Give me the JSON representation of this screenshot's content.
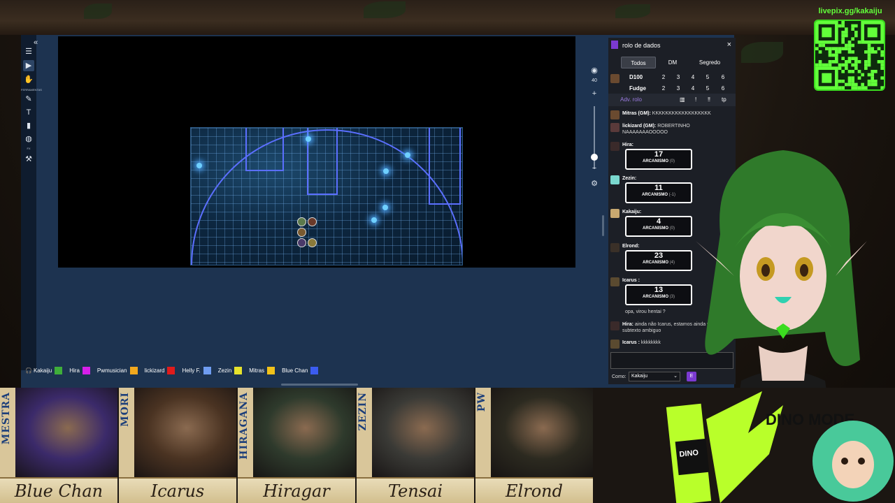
{
  "overlay": {
    "qr_label": "livepix.gg/kakaiju",
    "dino_text": "DINO MODE"
  },
  "vtt": {
    "tools": [
      {
        "name": "menu-icon",
        "glyph": "☰"
      },
      {
        "name": "select-tool-icon",
        "glyph": "▶"
      },
      {
        "name": "hand-tool-icon",
        "glyph": "✋"
      },
      {
        "name": "brush-tool-icon",
        "glyph": "✎"
      },
      {
        "name": "text-tool-icon",
        "glyph": "T"
      },
      {
        "name": "ruler-tool-icon",
        "glyph": "▮"
      },
      {
        "name": "globe-tool-icon",
        "glyph": "◍"
      },
      {
        "name": "wand-tool-icon",
        "glyph": "⚒"
      }
    ],
    "tools_label": "FERRAMENTAS",
    "fx_label": "FX",
    "zoom_level": "40",
    "players": [
      {
        "name": "Kakaiju",
        "color": "#3fae3a"
      },
      {
        "name": "Hira",
        "color": "#d61fe8"
      },
      {
        "name": "Pwmusician",
        "color": "#f2a81d"
      },
      {
        "name": "lickizard",
        "color": "#e01b1b"
      },
      {
        "name": "Helly F.",
        "color": "#6f9cf0"
      },
      {
        "name": "Zezin",
        "color": "#e6e22c"
      },
      {
        "name": "Mitras",
        "color": "#f2c21a"
      },
      {
        "name": "Blue Chan",
        "color": "#3b5cf0"
      }
    ]
  },
  "dice_panel": {
    "title": "rolo de dados",
    "close": "×",
    "tabs": [
      "Todos",
      "DM",
      "Segredo"
    ],
    "dice_rows": [
      {
        "die": "D100",
        "values": [
          "2",
          "3",
          "4",
          "5",
          "6"
        ]
      },
      {
        "die": "Fudge",
        "values": [
          "2",
          "3",
          "4",
          "5",
          "6"
        ]
      }
    ],
    "adv_label": "Adv. rolo",
    "adv_buttons": [
      "▥",
      "!",
      "‼",
      "tp"
    ],
    "chat": [
      {
        "who": "Mitras (GM):",
        "text": "KKKKKKKKKKKKKKKKKK"
      },
      {
        "who": "lickizard (GM):",
        "text": "ROBERTINHO NAAAAAAAOOOOO"
      },
      {
        "who": "Hira:",
        "roll": "17",
        "skill": "ARCANISMO",
        "mod": "(0)"
      },
      {
        "who": "Zezin:",
        "roll": "11",
        "skill": "ARCANISMO",
        "mod": "(-1)"
      },
      {
        "who": "Kakaiju:",
        "roll": "4",
        "skill": "ARCANISMO",
        "mod": "(0)"
      },
      {
        "who": "Elrond:",
        "roll": "23",
        "skill": "ARCANISMO",
        "mod": "(4)"
      },
      {
        "who": "Icarus :",
        "roll": "13",
        "skill": "ARCANISMO",
        "mod": "(3)"
      },
      {
        "who": "",
        "text": "opa, virou hentai ?"
      },
      {
        "who": "Hira:",
        "text": "ainda não Icarus, estamos ainda no subtexto ambiguo"
      },
      {
        "who": "Icarus :",
        "text": "kkkkkkkk"
      }
    ],
    "como_label": "Como:",
    "como_value": "Kakaiju"
  },
  "characters": [
    {
      "side": "MESTRA",
      "name": "Blue Chan",
      "tint": "#3b2a6a"
    },
    {
      "side": "MORI",
      "name": "Icarus",
      "tint": "#4a3322"
    },
    {
      "side": "HIRAGANA",
      "name": "Hiragar",
      "tint": "#2e3a2c"
    },
    {
      "side": "ZEZIN",
      "name": "Tensai",
      "tint": "#3a3a36"
    },
    {
      "side": "PW",
      "name": "Elrond",
      "tint": "#2c2a20"
    }
  ]
}
